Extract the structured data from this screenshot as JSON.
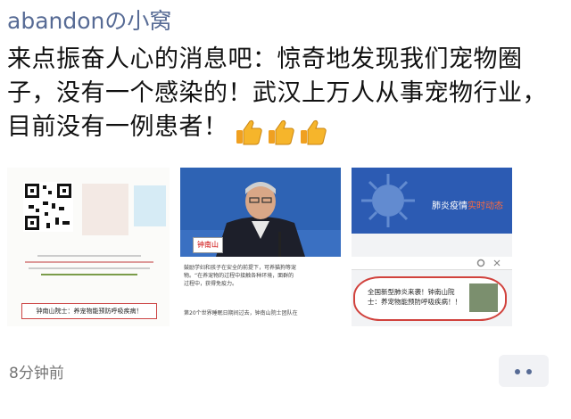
{
  "post": {
    "username": "abandonの小窝",
    "text": "来点振奋人心的消息吧：惊奇地发现我们宠物圈子，没有一个感染的！武汉上万人从事宠物行业，目前没有一例患者！",
    "emoji_icons": [
      "thumbs-up-icon",
      "thumbs-up-icon",
      "thumbs-up-icon"
    ],
    "timestamp": "8分钟前"
  },
  "images": {
    "image1": {
      "poster_caption": "钟南山院士：养宠物能预防呼吸疾病！",
      "qr_icon": "qr-code-icon"
    },
    "image2": {
      "name_tag": "钟南山",
      "article_lines": [
        "鼓励学妇和孩子在安全的前提下，可养猫狗等宠",
        "物。“在养宠物的过程中接触各种环境，面群的",
        "过程中，获得免疫力。",
        "第20个世界睡眠日期间过去，钟南山院士团队在"
      ]
    },
    "image3": {
      "banner": "肺炎疫情",
      "banner_accent": "实时动态",
      "card_text": "全国新型肺炎来袭！钟南山院士：养宠物能预防呼吸疾病！！"
    }
  },
  "colors": {
    "link": "#576b95",
    "text": "#111111",
    "muted": "#777777",
    "highlight_ring": "#d1423d"
  }
}
